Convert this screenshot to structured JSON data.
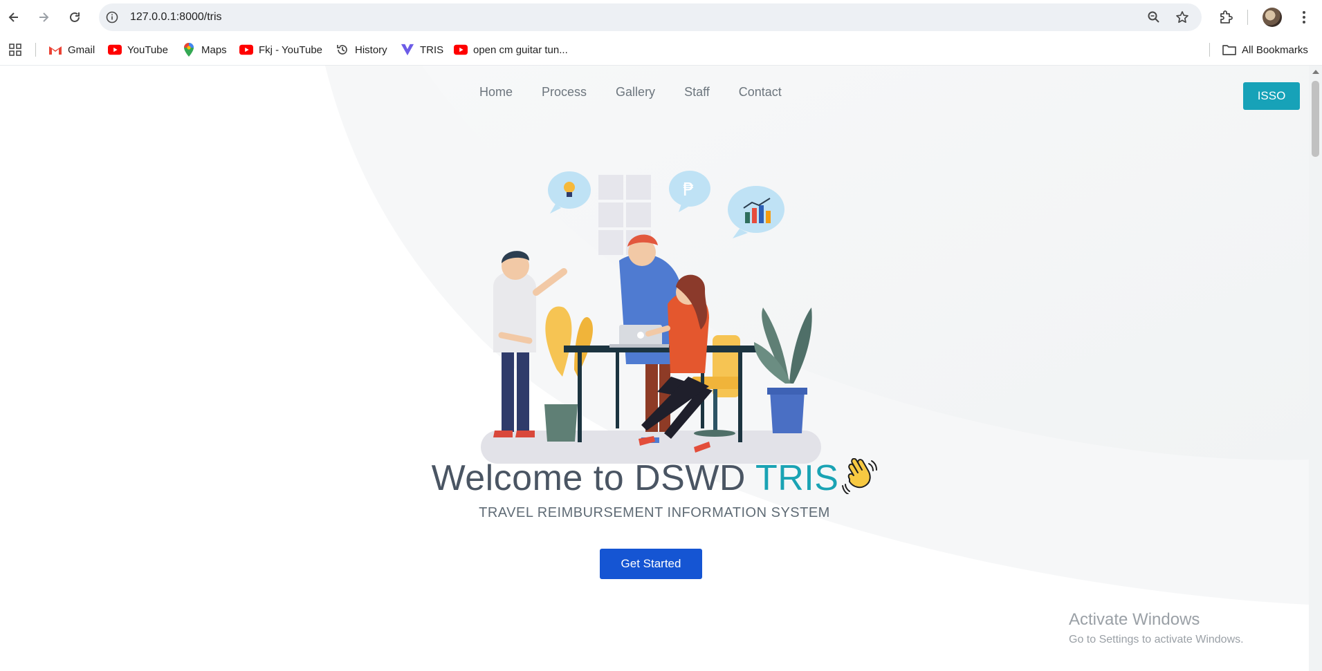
{
  "browser": {
    "url": "127.0.0.1:8000/tris",
    "icons": [
      "back-arrow-icon",
      "forward-arrow-icon",
      "reload-icon",
      "site-info-icon",
      "zoom-icon",
      "bookmark-star-icon",
      "extensions-icon",
      "profile-avatar",
      "kebab-menu-icon"
    ]
  },
  "bookmarks": {
    "items": [
      {
        "label": "Gmail",
        "icon": "gmail-icon"
      },
      {
        "label": "YouTube",
        "icon": "youtube-icon"
      },
      {
        "label": "Maps",
        "icon": "maps-pin-icon"
      },
      {
        "label": "Fkj - YouTube",
        "icon": "youtube-icon"
      },
      {
        "label": "History",
        "icon": "history-icon"
      },
      {
        "label": "TRIS",
        "icon": "tris-logo-icon"
      },
      {
        "label": "open cm guitar tun...",
        "icon": "youtube-icon"
      }
    ],
    "all_bookmarks": "All Bookmarks"
  },
  "site": {
    "nav": [
      "Home",
      "Process",
      "Gallery",
      "Staff",
      "Contact"
    ],
    "isso_button": "ISSO",
    "hero": {
      "welcome_prefix": "Welcome to DSWD ",
      "welcome_accent": "TRIS",
      "subtitle": "TRAVEL REIMBURSEMENT INFORMATION SYSTEM",
      "cta": "Get Started"
    },
    "colors": {
      "accent": "#1aa3b4",
      "cta": "#1555d3",
      "isso": "#17a2b8"
    }
  },
  "watermark": {
    "line1": "Activate Windows",
    "line2": "Go to Settings to activate Windows."
  }
}
